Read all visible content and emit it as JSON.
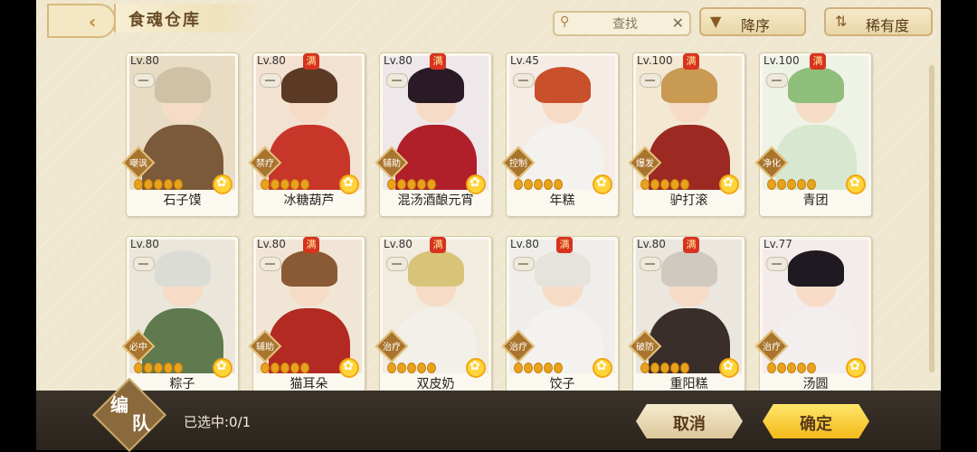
{
  "header": {
    "title": "食魂仓库",
    "search_placeholder": "查找",
    "sort_order_label": "降序",
    "sort_field_label": "稀有度"
  },
  "cards": [
    {
      "level": "Lv.80",
      "full_badge": "",
      "role": "嘲讽",
      "name": "石子馍",
      "stars": 5,
      "palette": {
        "bg": "#e9dcc4",
        "hair": "#cfc1a6",
        "body": "#7a5a3a"
      }
    },
    {
      "level": "Lv.80",
      "full_badge": "满",
      "role": "禁疗",
      "name": "冰糖葫芦",
      "stars": 5,
      "palette": {
        "bg": "#f3e2d2",
        "hair": "#5a3a24",
        "body": "#c8362a"
      }
    },
    {
      "level": "Lv.80",
      "full_badge": "满",
      "role": "辅助",
      "name": "混汤酒酿元宵",
      "stars": 5,
      "palette": {
        "bg": "#efe8ea",
        "hair": "#2a1a26",
        "body": "#b01f2a"
      }
    },
    {
      "level": "Lv.45",
      "full_badge": "",
      "role": "控制",
      "name": "年糕",
      "stars": 5,
      "palette": {
        "bg": "#f5ece6",
        "hair": "#c8502a",
        "body": "#f4f2ee"
      }
    },
    {
      "level": "Lv.100",
      "full_badge": "满",
      "role": "爆发",
      "name": "驴打滚",
      "stars": 5,
      "palette": {
        "bg": "#f3e8d2",
        "hair": "#c89a52",
        "body": "#9c2a22"
      }
    },
    {
      "level": "Lv.100",
      "full_badge": "满",
      "role": "净化",
      "name": "青团",
      "stars": 5,
      "palette": {
        "bg": "#eef3e6",
        "hair": "#8fbf7a",
        "body": "#d8e8d0"
      }
    },
    {
      "level": "Lv.80",
      "full_badge": "",
      "role": "必中",
      "name": "粽子",
      "stars": 5,
      "palette": {
        "bg": "#eae6da",
        "hair": "#dcdcd6",
        "body": "#5f7a4f"
      }
    },
    {
      "level": "Lv.80",
      "full_badge": "满",
      "role": "辅助",
      "name": "猫耳朵",
      "stars": 5,
      "palette": {
        "bg": "#f1e6d6",
        "hair": "#8a5a34",
        "body": "#b32a22"
      }
    },
    {
      "level": "Lv.80",
      "full_badge": "满",
      "role": "治疗",
      "name": "双皮奶",
      "stars": 5,
      "palette": {
        "bg": "#f2ebe0",
        "hair": "#d8c478",
        "body": "#f3f0ea"
      }
    },
    {
      "level": "Lv.80",
      "full_badge": "满",
      "role": "治疗",
      "name": "饺子",
      "stars": 5,
      "palette": {
        "bg": "#f0eeeb",
        "hair": "#e6e2dc",
        "body": "#f4f2ee"
      }
    },
    {
      "level": "Lv.80",
      "full_badge": "满",
      "role": "破防",
      "name": "重阳糕",
      "stars": 5,
      "palette": {
        "bg": "#ebe6de",
        "hair": "#cfc9c0",
        "body": "#3a2e2a"
      }
    },
    {
      "level": "Lv.77",
      "full_badge": "",
      "role": "治疗",
      "name": "汤圆",
      "stars": 5,
      "palette": {
        "bg": "#f4ecea",
        "hair": "#1f1a22",
        "body": "#f3efee"
      }
    }
  ],
  "footer": {
    "team_char1": "编",
    "team_char2": "队",
    "selected_text": "已选中:0/1",
    "cancel_label": "取消",
    "confirm_label": "确定"
  }
}
